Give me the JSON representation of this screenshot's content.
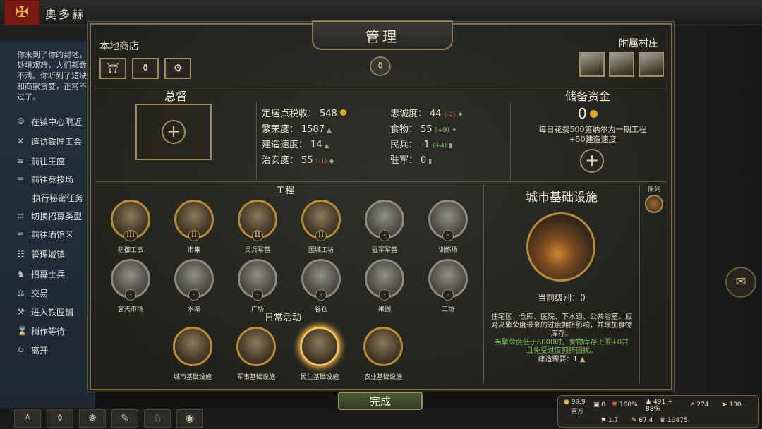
{
  "topbar": {
    "town_name": "奥多赫",
    "numbers": [
      "1587",
      "55",
      "44",
      "55",
      "-1",
      "0"
    ]
  },
  "sidebar": {
    "intro": "你来到了你的封地，处境艰难，人们都数不清。你听到了短缺和商家贪婪，正常不过了。",
    "items": [
      {
        "label": "在镇中心附近",
        "icon": "walk-icon"
      },
      {
        "label": "造访铁匠工会",
        "icon": "anvil-icon"
      },
      {
        "label": "前往王座",
        "icon": "throne-icon"
      },
      {
        "label": "前往竞技场",
        "icon": "arena-icon"
      },
      {
        "label": "执行秘密任务",
        "icon": ""
      },
      {
        "label": "切换招募类型",
        "icon": "swap-icon"
      },
      {
        "label": "前往酒馆区",
        "icon": "tavern-icon"
      },
      {
        "label": "管理城镇",
        "icon": "manage-icon"
      },
      {
        "label": "招募士兵",
        "icon": "recruit-icon"
      },
      {
        "label": "交易",
        "icon": "trade-icon"
      },
      {
        "label": "进入铁匠铺",
        "icon": "smith-icon"
      },
      {
        "label": "稍作等待",
        "icon": "hourglass-icon"
      },
      {
        "label": "离开",
        "icon": "leave-icon"
      }
    ]
  },
  "panel": {
    "title": "管理",
    "local_shop": "本地商店",
    "shop_icons": [
      "stall-icon",
      "anvil-icon",
      "bag-icon"
    ],
    "villages_label": "附属村庄",
    "governor": {
      "title": "总督"
    },
    "stats_left": [
      {
        "label": "定居点税收：",
        "value": "548",
        "delta": "",
        "delta_class": "",
        "icon": "coin"
      },
      {
        "label": "繁荣度：",
        "value": "1587",
        "delta": "",
        "delta_class": "",
        "icon": "▲"
      },
      {
        "label": "建造速度：",
        "value": "14",
        "delta": "",
        "delta_class": "",
        "icon": "▲"
      },
      {
        "label": "治安度：",
        "value": "55",
        "delta": "(-1)",
        "delta_class": "red",
        "icon": "◆"
      }
    ],
    "stats_right": [
      {
        "label": "忠诚度：",
        "value": "44",
        "delta": "(-2)",
        "delta_class": "red",
        "icon": "♦"
      },
      {
        "label": "食物：",
        "value": "55",
        "delta": "(+9)",
        "delta_class": "green",
        "icon": "✦"
      },
      {
        "label": "民兵：",
        "value": "-1",
        "delta": "(+4)",
        "delta_class": "green",
        "icon": "▮"
      },
      {
        "label": "驻军：",
        "value": "0",
        "delta": "",
        "delta_class": "",
        "icon": "▮"
      }
    ],
    "reserve": {
      "title": "储备资金",
      "amount": "0",
      "line1": "每日花费500第纳尔为一期工程",
      "line2": "+50建造速度"
    },
    "projects_title": "工程",
    "projects": [
      {
        "name": "防御工事",
        "level": "III",
        "active": true
      },
      {
        "name": "市集",
        "level": "II",
        "active": true
      },
      {
        "name": "民兵军营",
        "level": "II",
        "active": true
      },
      {
        "name": "围城工坊",
        "level": "II",
        "active": true
      },
      {
        "name": "驻军军营",
        "level": "-",
        "active": false
      },
      {
        "name": "训练场",
        "level": "-",
        "active": false
      },
      {
        "name": "露天市场",
        "level": "-",
        "active": false
      },
      {
        "name": "水渠",
        "level": "-",
        "active": false
      },
      {
        "name": "广场",
        "level": "-",
        "active": false
      },
      {
        "name": "谷仓",
        "level": "-",
        "active": false
      },
      {
        "name": "果园",
        "level": "-",
        "active": false
      },
      {
        "name": "工坊",
        "level": "-",
        "active": false
      }
    ],
    "daily_title": "日常活动",
    "daily": [
      {
        "name": "城市基础设施"
      },
      {
        "name": "军事基础设施"
      },
      {
        "name": "民生基础设施"
      },
      {
        "name": "农业基础设施"
      }
    ],
    "detail": {
      "title": "城市基础设施",
      "level": "当前级别：0",
      "desc": "住宅区、仓库、医院、下水道、公共浴室。应对高繁荣度带来的过度拥挤影响，并增加食物库存。",
      "bonus": "当繁荣度低于6000时，食物库存上限+0并且免受过度拥挤困扰。",
      "requirement": "建造需要：1"
    },
    "queue_label": "队列",
    "done_button": "完成"
  },
  "status": {
    "gold": "99.9",
    "gold_unit": "百万",
    "food": "0",
    "health": "100%",
    "troops": "491 + 88伤",
    "speed_a": "274",
    "morale": "100",
    "influence": "1.7",
    "view": "67.4",
    "renown": "10475"
  }
}
